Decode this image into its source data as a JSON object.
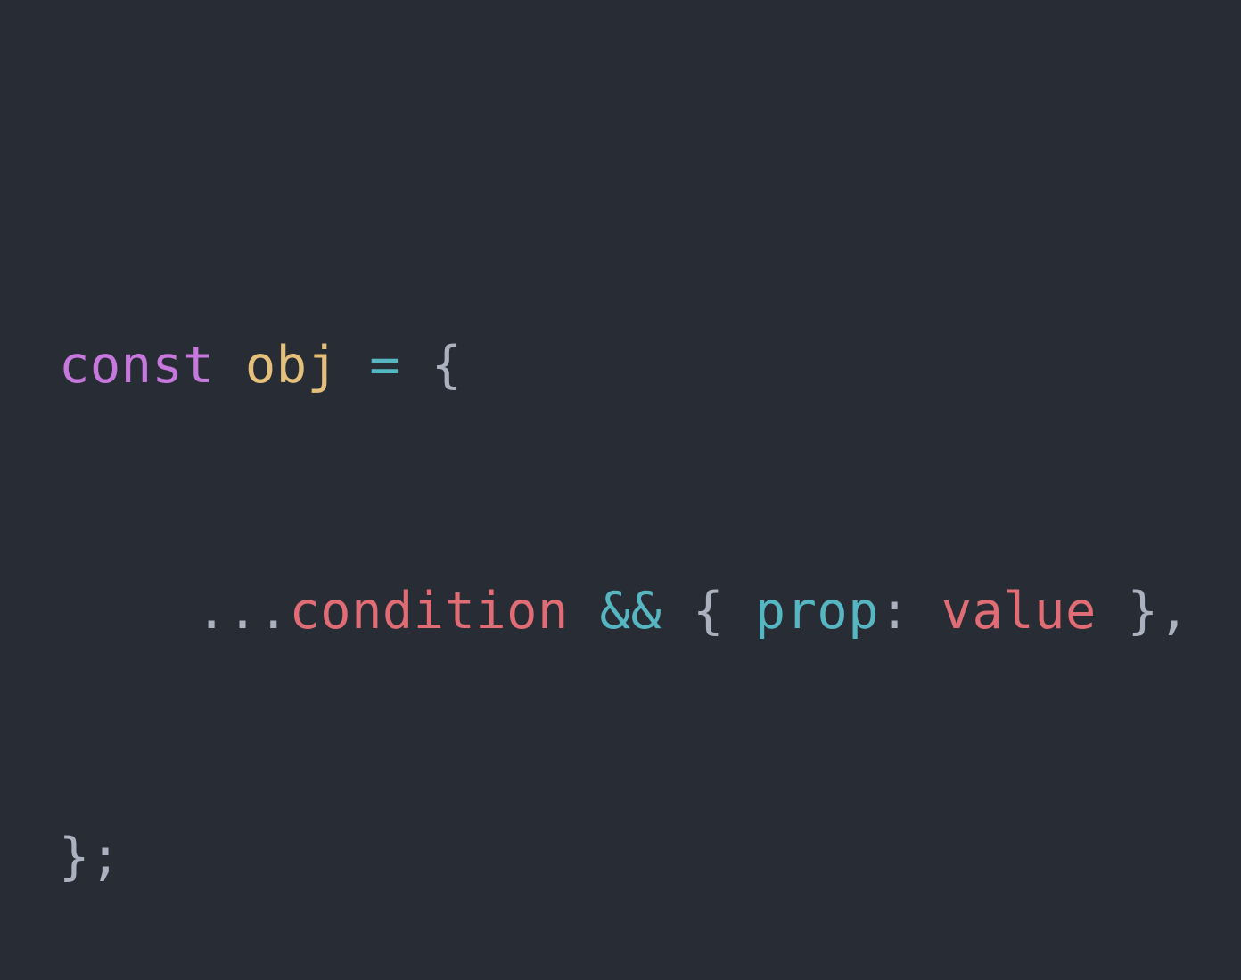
{
  "colors": {
    "background": "#282c34",
    "keyword": "#c678dd",
    "variable": "#e5c07b",
    "operator": "#56b6c2",
    "punctuation": "#abb2bf",
    "identifier": "#e06c75",
    "property": "#56b6c2"
  },
  "code": {
    "line1": {
      "keyword": "const",
      "name": "obj",
      "equals": "=",
      "open_brace": "{"
    },
    "line2": {
      "spread": "...",
      "condition": "condition",
      "and_op": "&&",
      "open_brace": "{",
      "prop": "prop",
      "colon": ":",
      "value": "value",
      "close_brace": "},"
    },
    "line3": {
      "close": "};"
    }
  }
}
